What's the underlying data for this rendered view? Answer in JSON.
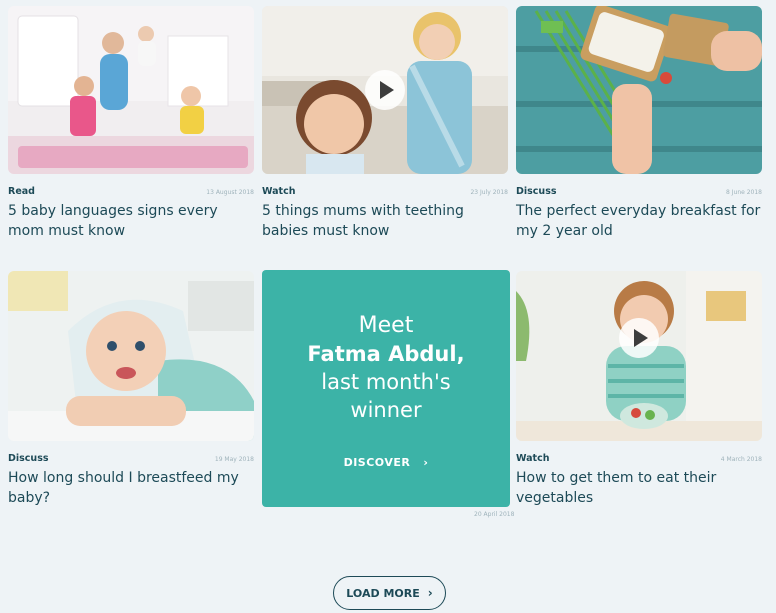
{
  "colors": {
    "accent": "#3cb3a7",
    "text": "#1d4a57",
    "background": "#eef3f6"
  },
  "articles": [
    {
      "category": "Read",
      "date": "13 August 2018",
      "title": "5 baby languages signs every mom must know",
      "media": "image"
    },
    {
      "category": "Watch",
      "date": "23 July 2018",
      "title": "5 things mums with teething babies must know",
      "media": "video"
    },
    {
      "category": "Discuss",
      "date": "8 June 2018",
      "title": "The perfect everyday breakfast for my 2 year old",
      "media": "image"
    },
    {
      "category": "Discuss",
      "date": "19 May 2018",
      "title": "How long should I breastfeed my baby?",
      "media": "image"
    },
    {
      "category": "Watch",
      "date": "4 March 2018",
      "title": "How to get them to eat their vegetables",
      "media": "video"
    }
  ],
  "promo": {
    "line1": "Meet",
    "name": "Fatma Abdul,",
    "line3": "last month's",
    "line4": "winner",
    "cta": "DISCOVER",
    "date": "20 April 2018"
  },
  "load_more": "LOAD MORE",
  "icons": {
    "play": "play-icon",
    "chevron": "chevron-right-icon"
  }
}
